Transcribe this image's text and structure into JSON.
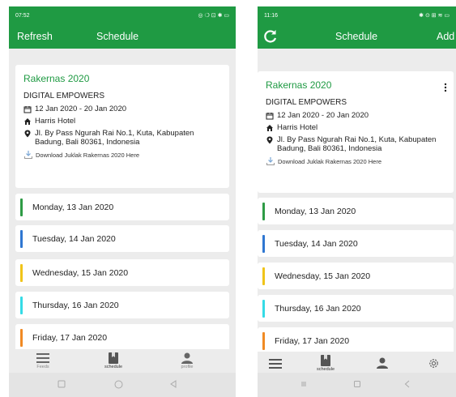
{
  "left": {
    "status_time": "07:52",
    "status_right": "◎ ❍ ⊡ ✱ ▭",
    "refresh_label": "Refresh",
    "title": "Schedule",
    "event": {
      "title": "Rakernas 2020",
      "organizer": "DIGITAL EMPOWERS",
      "date_range": "12 Jan 2020  -  20 Jan 2020",
      "venue": "Harris Hotel",
      "address": "Jl. By Pass Ngurah Rai No.1, Kuta, Kabupaten Badung, Bali 80361, Indonesia",
      "download_label": "Download Juklak Rakernas 2020 Here"
    },
    "days": [
      {
        "label": "Monday, 13 Jan 2020",
        "color": "#2e9b45"
      },
      {
        "label": "Tuesday, 14 Jan 2020",
        "color": "#2f77d1"
      },
      {
        "label": "Wednesday, 15 Jan 2020",
        "color": "#f0c419"
      },
      {
        "label": "Thursday, 16 Jan 2020",
        "color": "#35dbe6"
      },
      {
        "label": "Friday, 17 Jan 2020",
        "color": "#f08a24"
      }
    ],
    "nav": {
      "feeds": "Feeds",
      "schedule": "schedule",
      "profile": "profile"
    }
  },
  "right": {
    "status_time": "11:16",
    "status_right": "✱ ⊙ ⊞ ≋ ▭",
    "title": "Schedule",
    "add_label": "Add",
    "event": {
      "title": "Rakernas 2020",
      "organizer": "DIGITAL EMPOWERS",
      "date_range": "12 Jan 2020  -  20 Jan 2020",
      "venue": "Harris Hotel",
      "address": "Jl. By Pass Ngurah Rai No.1, Kuta, Kabupaten Badung, Bali 80361, Indonesia",
      "download_label": "Download Juklak Rakernas 2020 Here"
    },
    "days": [
      {
        "label": "Monday, 13 Jan 2020",
        "color": "#2e9b45"
      },
      {
        "label": "Tuesday, 14 Jan 2020",
        "color": "#2f77d1"
      },
      {
        "label": "Wednesday, 15 Jan 2020",
        "color": "#f0c419"
      },
      {
        "label": "Thursday, 16 Jan 2020",
        "color": "#35dbe6"
      },
      {
        "label": "Friday, 17 Jan 2020",
        "color": "#f08a24"
      }
    ],
    "nav": {
      "schedule": "schedule"
    }
  },
  "colors": {
    "brand_green": "#1f9a43",
    "background": "#ececec"
  }
}
